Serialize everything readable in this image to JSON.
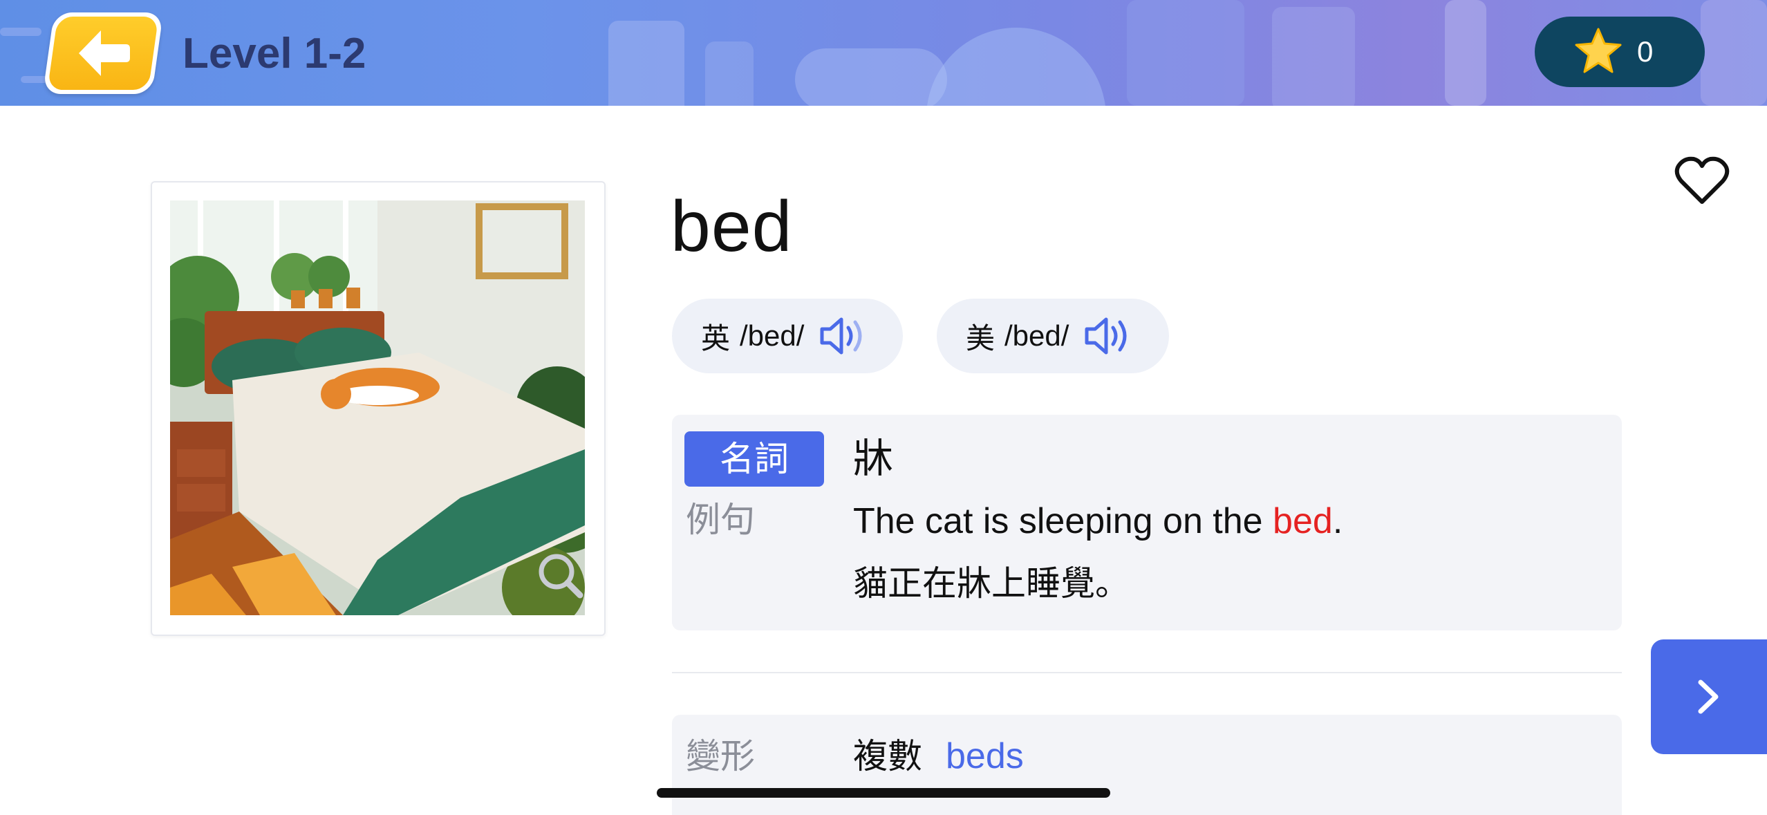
{
  "header": {
    "back_icon": "arrow-left-icon",
    "level_title": "Level 1-2",
    "star_icon": "star-icon",
    "star_count": "0"
  },
  "image_card": {
    "image_description_icon": "bed-with-cat-illustration",
    "zoom_icon": "magnifier-icon"
  },
  "word": {
    "text": "bed",
    "favorite_icon": "heart-outline-icon"
  },
  "pronunciations": [
    {
      "region": "英",
      "ipa": "/bed/",
      "icon": "speaker-icon"
    },
    {
      "region": "美",
      "ipa": "/bed/",
      "icon": "speaker-icon"
    }
  ],
  "definition": {
    "pos": "名詞",
    "meaning": "牀",
    "example_label": "例句",
    "example_en_before": "The cat is sleeping on the ",
    "example_en_highlight": "bed",
    "example_en_after": ".",
    "example_zh": "貓正在牀上睡覺。"
  },
  "inflection": {
    "label": "變形",
    "type": "複數",
    "value": "beds"
  },
  "next_button": {
    "icon": "chevron-right-icon"
  },
  "colors": {
    "accent": "#4a6ae8",
    "highlight": "#e52222",
    "star_pill": "#0e4560",
    "back_button": "#f9b514"
  }
}
